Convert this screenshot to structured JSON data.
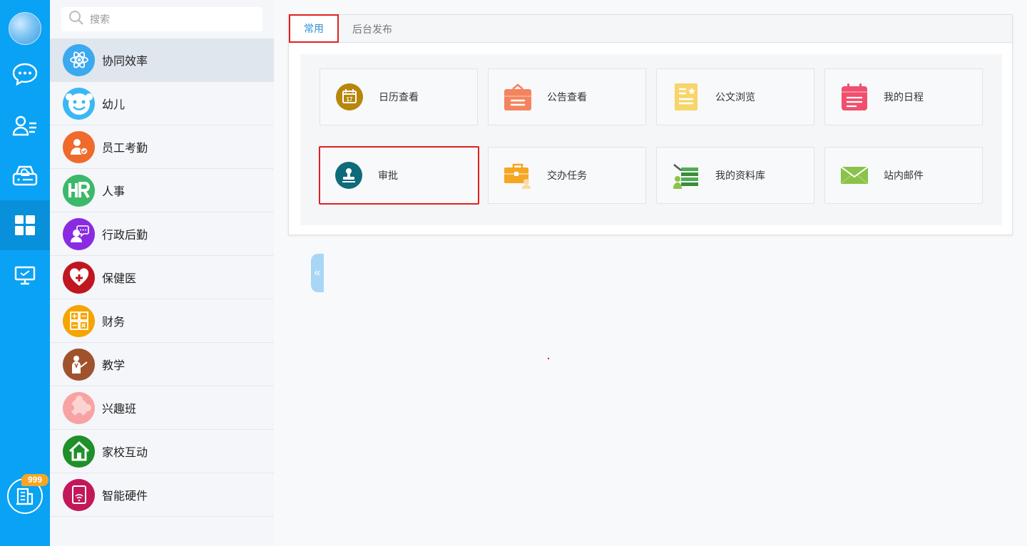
{
  "search": {
    "placeholder": "搜索"
  },
  "rail": {
    "items": [
      "chat-icon",
      "contacts-icon",
      "cloud-drive-icon",
      "apps-grid-icon",
      "desktop-icon"
    ],
    "active_index": 3,
    "badge": "999"
  },
  "sidebar": {
    "items": [
      {
        "label": "协同效率",
        "icon": "atom-icon",
        "color": "#3aa9ef"
      },
      {
        "label": "幼儿",
        "icon": "smiley-icon",
        "color": "#3ab8f5"
      },
      {
        "label": "员工考勤",
        "icon": "staff-check-icon",
        "color": "#f06a2c"
      },
      {
        "label": "人事",
        "icon": "hr-icon",
        "color": "#3cb86a"
      },
      {
        "label": "行政后勤",
        "icon": "admin-icon",
        "color": "#8a2be2"
      },
      {
        "label": "保健医",
        "icon": "heart-plus-icon",
        "color": "#c0161f"
      },
      {
        "label": "财务",
        "icon": "calculator-icon",
        "color": "#f5a400"
      },
      {
        "label": "教学",
        "icon": "teacher-icon",
        "color": "#a0522d"
      },
      {
        "label": "兴趣班",
        "icon": "puzzle-icon",
        "color": "#f7a3a3"
      },
      {
        "label": "家校互动",
        "icon": "home-icon",
        "color": "#1f8f2a"
      },
      {
        "label": "智能硬件",
        "icon": "device-icon",
        "color": "#c2185b"
      }
    ],
    "active_index": 0
  },
  "main": {
    "tabs": [
      {
        "label": "常用"
      },
      {
        "label": "后台发布"
      }
    ],
    "active_tab": 0,
    "apps": [
      {
        "label": "日历查看",
        "icon": "calendar-icon",
        "color": "#b8860b"
      },
      {
        "label": "公告查看",
        "icon": "notice-icon",
        "color": "#f4845f"
      },
      {
        "label": "公文浏览",
        "icon": "document-icon",
        "color": "#f7d56b"
      },
      {
        "label": "我的日程",
        "icon": "schedule-icon",
        "color": "#f0506e"
      },
      {
        "label": "审批",
        "icon": "stamp-icon",
        "color": "#0e6b7a"
      },
      {
        "label": "交办任务",
        "icon": "briefcase-icon",
        "color": "#f5a623"
      },
      {
        "label": "我的资料库",
        "icon": "library-icon",
        "color": "#4caf50"
      },
      {
        "label": "站内邮件",
        "icon": "mail-icon",
        "color": "#8bc34a"
      }
    ]
  }
}
